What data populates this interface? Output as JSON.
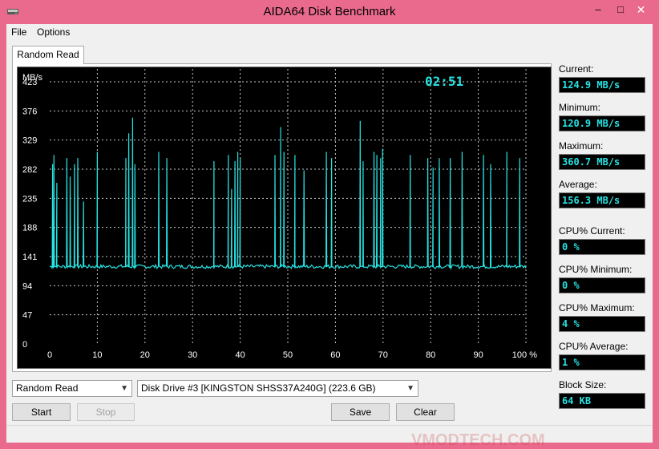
{
  "window": {
    "title": "AIDA64 Disk Benchmark",
    "min_glyph": "–",
    "max_glyph": "□",
    "close_glyph": "✕",
    "frame_color": "#ea6a8e"
  },
  "menu": {
    "file": "File",
    "options": "Options"
  },
  "tab": {
    "label": "Random Read"
  },
  "chart_data": {
    "type": "line",
    "timer": "02:51",
    "y_unit": "MB/s",
    "y_ticks": [
      "423",
      "376",
      "329",
      "282",
      "235",
      "188",
      "141",
      "94",
      "47",
      "0"
    ],
    "x_ticks": [
      "0",
      "10",
      "20",
      "30",
      "40",
      "50",
      "60",
      "70",
      "80",
      "90",
      "100 %"
    ],
    "xlim": [
      0,
      100
    ],
    "ylim": [
      0,
      423
    ],
    "grid": true,
    "line_color": "#27e2e2",
    "baseline": 124.9,
    "spikes": [
      [
        0.6,
        290
      ],
      [
        0.9,
        305
      ],
      [
        1.5,
        260
      ],
      [
        3.6,
        300
      ],
      [
        4.3,
        270
      ],
      [
        5.2,
        290
      ],
      [
        5.9,
        300
      ],
      [
        7.1,
        230
      ],
      [
        10.0,
        310
      ],
      [
        16.0,
        300
      ],
      [
        16.6,
        340
      ],
      [
        17.4,
        365
      ],
      [
        17.9,
        290
      ],
      [
        22.9,
        310
      ],
      [
        24.6,
        300
      ],
      [
        34.5,
        295
      ],
      [
        37.5,
        305
      ],
      [
        38.2,
        250
      ],
      [
        38.9,
        295
      ],
      [
        39.5,
        310
      ],
      [
        40.0,
        300
      ],
      [
        47.3,
        305
      ],
      [
        48.5,
        350
      ],
      [
        49.2,
        310
      ],
      [
        51.5,
        305
      ],
      [
        53.4,
        280
      ],
      [
        58.1,
        310
      ],
      [
        59.2,
        300
      ],
      [
        65.2,
        360
      ],
      [
        65.8,
        295
      ],
      [
        68.1,
        310
      ],
      [
        68.7,
        305
      ],
      [
        69.5,
        300
      ],
      [
        69.9,
        315
      ],
      [
        75.7,
        305
      ],
      [
        79.4,
        300
      ],
      [
        80.5,
        285
      ],
      [
        81.8,
        300
      ],
      [
        84.1,
        300
      ],
      [
        86.6,
        310
      ],
      [
        91.1,
        305
      ],
      [
        92.6,
        290
      ],
      [
        96.0,
        310
      ],
      [
        98.7,
        300
      ]
    ]
  },
  "stats": {
    "current_label": "Current:",
    "current_value": "124.9 MB/s",
    "minimum_label": "Minimum:",
    "minimum_value": "120.9 MB/s",
    "maximum_label": "Maximum:",
    "maximum_value": "360.7 MB/s",
    "average_label": "Average:",
    "average_value": "156.3 MB/s",
    "cpu_current_label": "CPU% Current:",
    "cpu_current_value": "0 %",
    "cpu_minimum_label": "CPU% Minimum:",
    "cpu_minimum_value": "0 %",
    "cpu_maximum_label": "CPU% Maximum:",
    "cpu_maximum_value": "4 %",
    "cpu_average_label": "CPU% Average:",
    "cpu_average_value": "1 %",
    "block_size_label": "Block Size:",
    "block_size_value": "64 KB"
  },
  "controls": {
    "test_select": "Random Read",
    "drive_select": "Disk Drive #3  [KINGSTON SHSS37A240G]  (223.6 GB)",
    "start": "Start",
    "stop": "Stop",
    "save": "Save",
    "clear": "Clear"
  },
  "watermark": "VMODTECH.COM"
}
